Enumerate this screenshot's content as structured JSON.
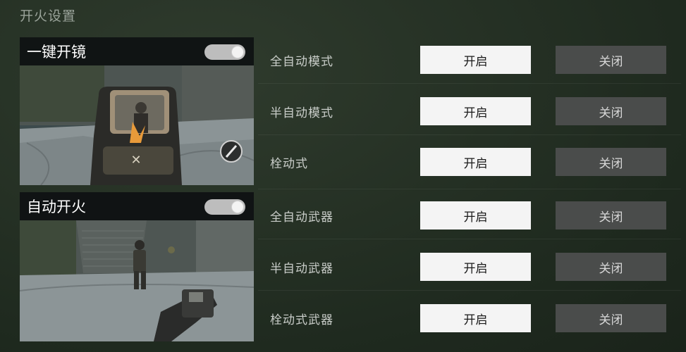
{
  "page": {
    "title": "开火设置"
  },
  "cards": [
    {
      "title": "一键开镜",
      "toggle_on": true
    },
    {
      "title": "自动开火",
      "toggle_on": true
    }
  ],
  "rows": [
    {
      "label": "全自动模式",
      "on_label": "开启",
      "off_label": "关闭",
      "selected": "on"
    },
    {
      "label": "半自动模式",
      "on_label": "开启",
      "off_label": "关闭",
      "selected": "on"
    },
    {
      "label": "栓动式",
      "on_label": "开启",
      "off_label": "关闭",
      "selected": "on"
    },
    {
      "label": "全自动武器",
      "on_label": "开启",
      "off_label": "关闭",
      "selected": "on"
    },
    {
      "label": "半自动武器",
      "on_label": "开启",
      "off_label": "关闭",
      "selected": "on"
    },
    {
      "label": "栓动式武器",
      "on_label": "开启",
      "off_label": "关闭",
      "selected": "on"
    }
  ]
}
